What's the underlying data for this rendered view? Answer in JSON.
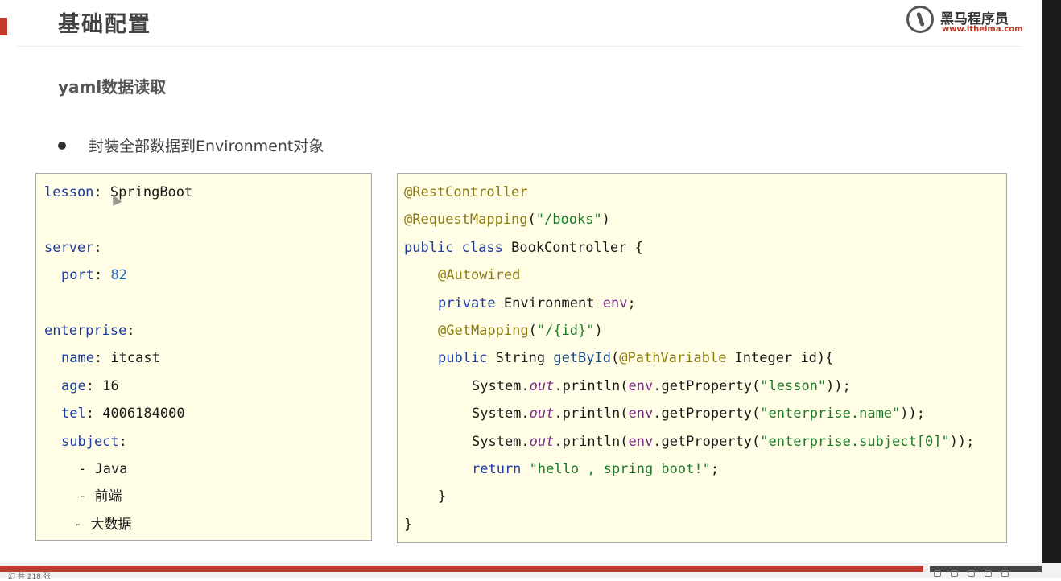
{
  "slide": {
    "title": "基础配置",
    "subtitle": "yaml数据读取",
    "bullet": "封装全部数据到Environment对象"
  },
  "logo": {
    "name": "黑马程序员",
    "url": "www.itheima.com"
  },
  "yaml": {
    "lesson_key": "lesson",
    "lesson_value": "SpringBoot",
    "server_key": "server",
    "port_key": "port",
    "port_value": "82",
    "enterprise_key": "enterprise",
    "name_key": "name",
    "name_value": "itcast",
    "age_key": "age",
    "age_value": "16",
    "tel_key": "tel",
    "tel_value": "4006184000",
    "subject_key": "subject",
    "subject_items": [
      "Java",
      "前端",
      "大数据"
    ]
  },
  "java": {
    "ann_rest": "@RestController",
    "ann_mapping": "@RequestMapping",
    "path_books": "\"/books\"",
    "kw_public": "public",
    "kw_class": "class",
    "class_name": "BookController",
    "ann_autowired": "@Autowired",
    "kw_private": "private",
    "type_env": "Environment",
    "field_env": "env",
    "ann_get": "@GetMapping",
    "path_id": "\"/{id}\"",
    "type_string": "String",
    "method_get": "getById",
    "ann_path": "@PathVariable",
    "param": "Integer id",
    "system": "System.",
    "out": "out",
    "println": ".println(",
    "get_property": ".getProperty(",
    "str_lesson": "\"lesson\"",
    "str_name": "\"enterprise.name\"",
    "str_subject": "\"enterprise.subject[0]\"",
    "kw_return": "return",
    "str_return": "\"hello , spring boot!\""
  },
  "status": {
    "text": "幻 共 218 张"
  }
}
